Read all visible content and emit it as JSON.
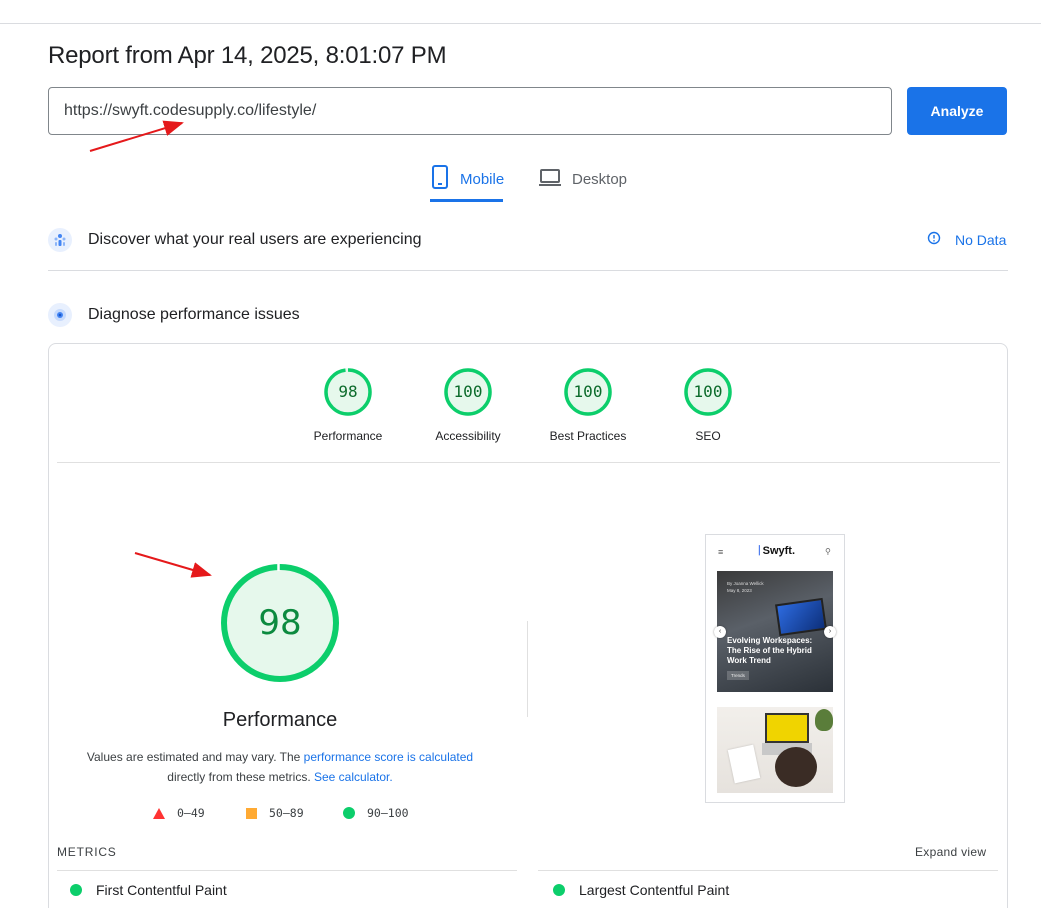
{
  "report": {
    "title": "Report from Apr 14, 2025, 8:01:07 PM"
  },
  "url_bar": {
    "value": "https://swyft.codesupply.co/lifestyle/",
    "analyze_label": "Analyze"
  },
  "device_tabs": [
    {
      "label": "Mobile",
      "selected": true,
      "icon": "phone-icon"
    },
    {
      "label": "Desktop",
      "selected": false,
      "icon": "laptop-icon"
    }
  ],
  "real_users": {
    "label": "Discover what your real users are experiencing",
    "status": "No Data",
    "icon": "users-icon"
  },
  "diagnose": {
    "label": "Diagnose performance issues",
    "icon": "lighthouse-icon"
  },
  "scores": [
    {
      "label": "Performance",
      "score": "98"
    },
    {
      "label": "Accessibility",
      "score": "100"
    },
    {
      "label": "Best Practices",
      "score": "100"
    },
    {
      "label": "SEO",
      "score": "100"
    }
  ],
  "performance": {
    "score": "98",
    "title": "Performance",
    "desc_prefix": "Values are estimated and may vary. The ",
    "desc_link1": "performance score is calculated",
    "desc_middle": " directly from these metrics. ",
    "desc_link2": "See calculator."
  },
  "legend": [
    {
      "range": "0–49",
      "color": "#ff3333"
    },
    {
      "range": "50–89",
      "color": "#ffaa33"
    },
    {
      "range": "90–100",
      "color": "#0cce6b"
    }
  ],
  "thumbnail": {
    "logo": "Swyft.",
    "author": "By Joanna Wellick",
    "date": "May 8, 2023",
    "article_title": "Evolving Workspaces: The Rise of the Hybrid Work Trend",
    "tag": "Trends"
  },
  "metrics": {
    "heading": "METRICS",
    "expand_label": "Expand view",
    "items": [
      {
        "label": "First Contentful Paint"
      },
      {
        "label": "Largest Contentful Paint"
      }
    ]
  },
  "colors": {
    "accent": "#1a73e8",
    "pass": "#0cce6b",
    "pass_text": "#0c6b2b",
    "annotation_arrow": "#e5191b"
  }
}
